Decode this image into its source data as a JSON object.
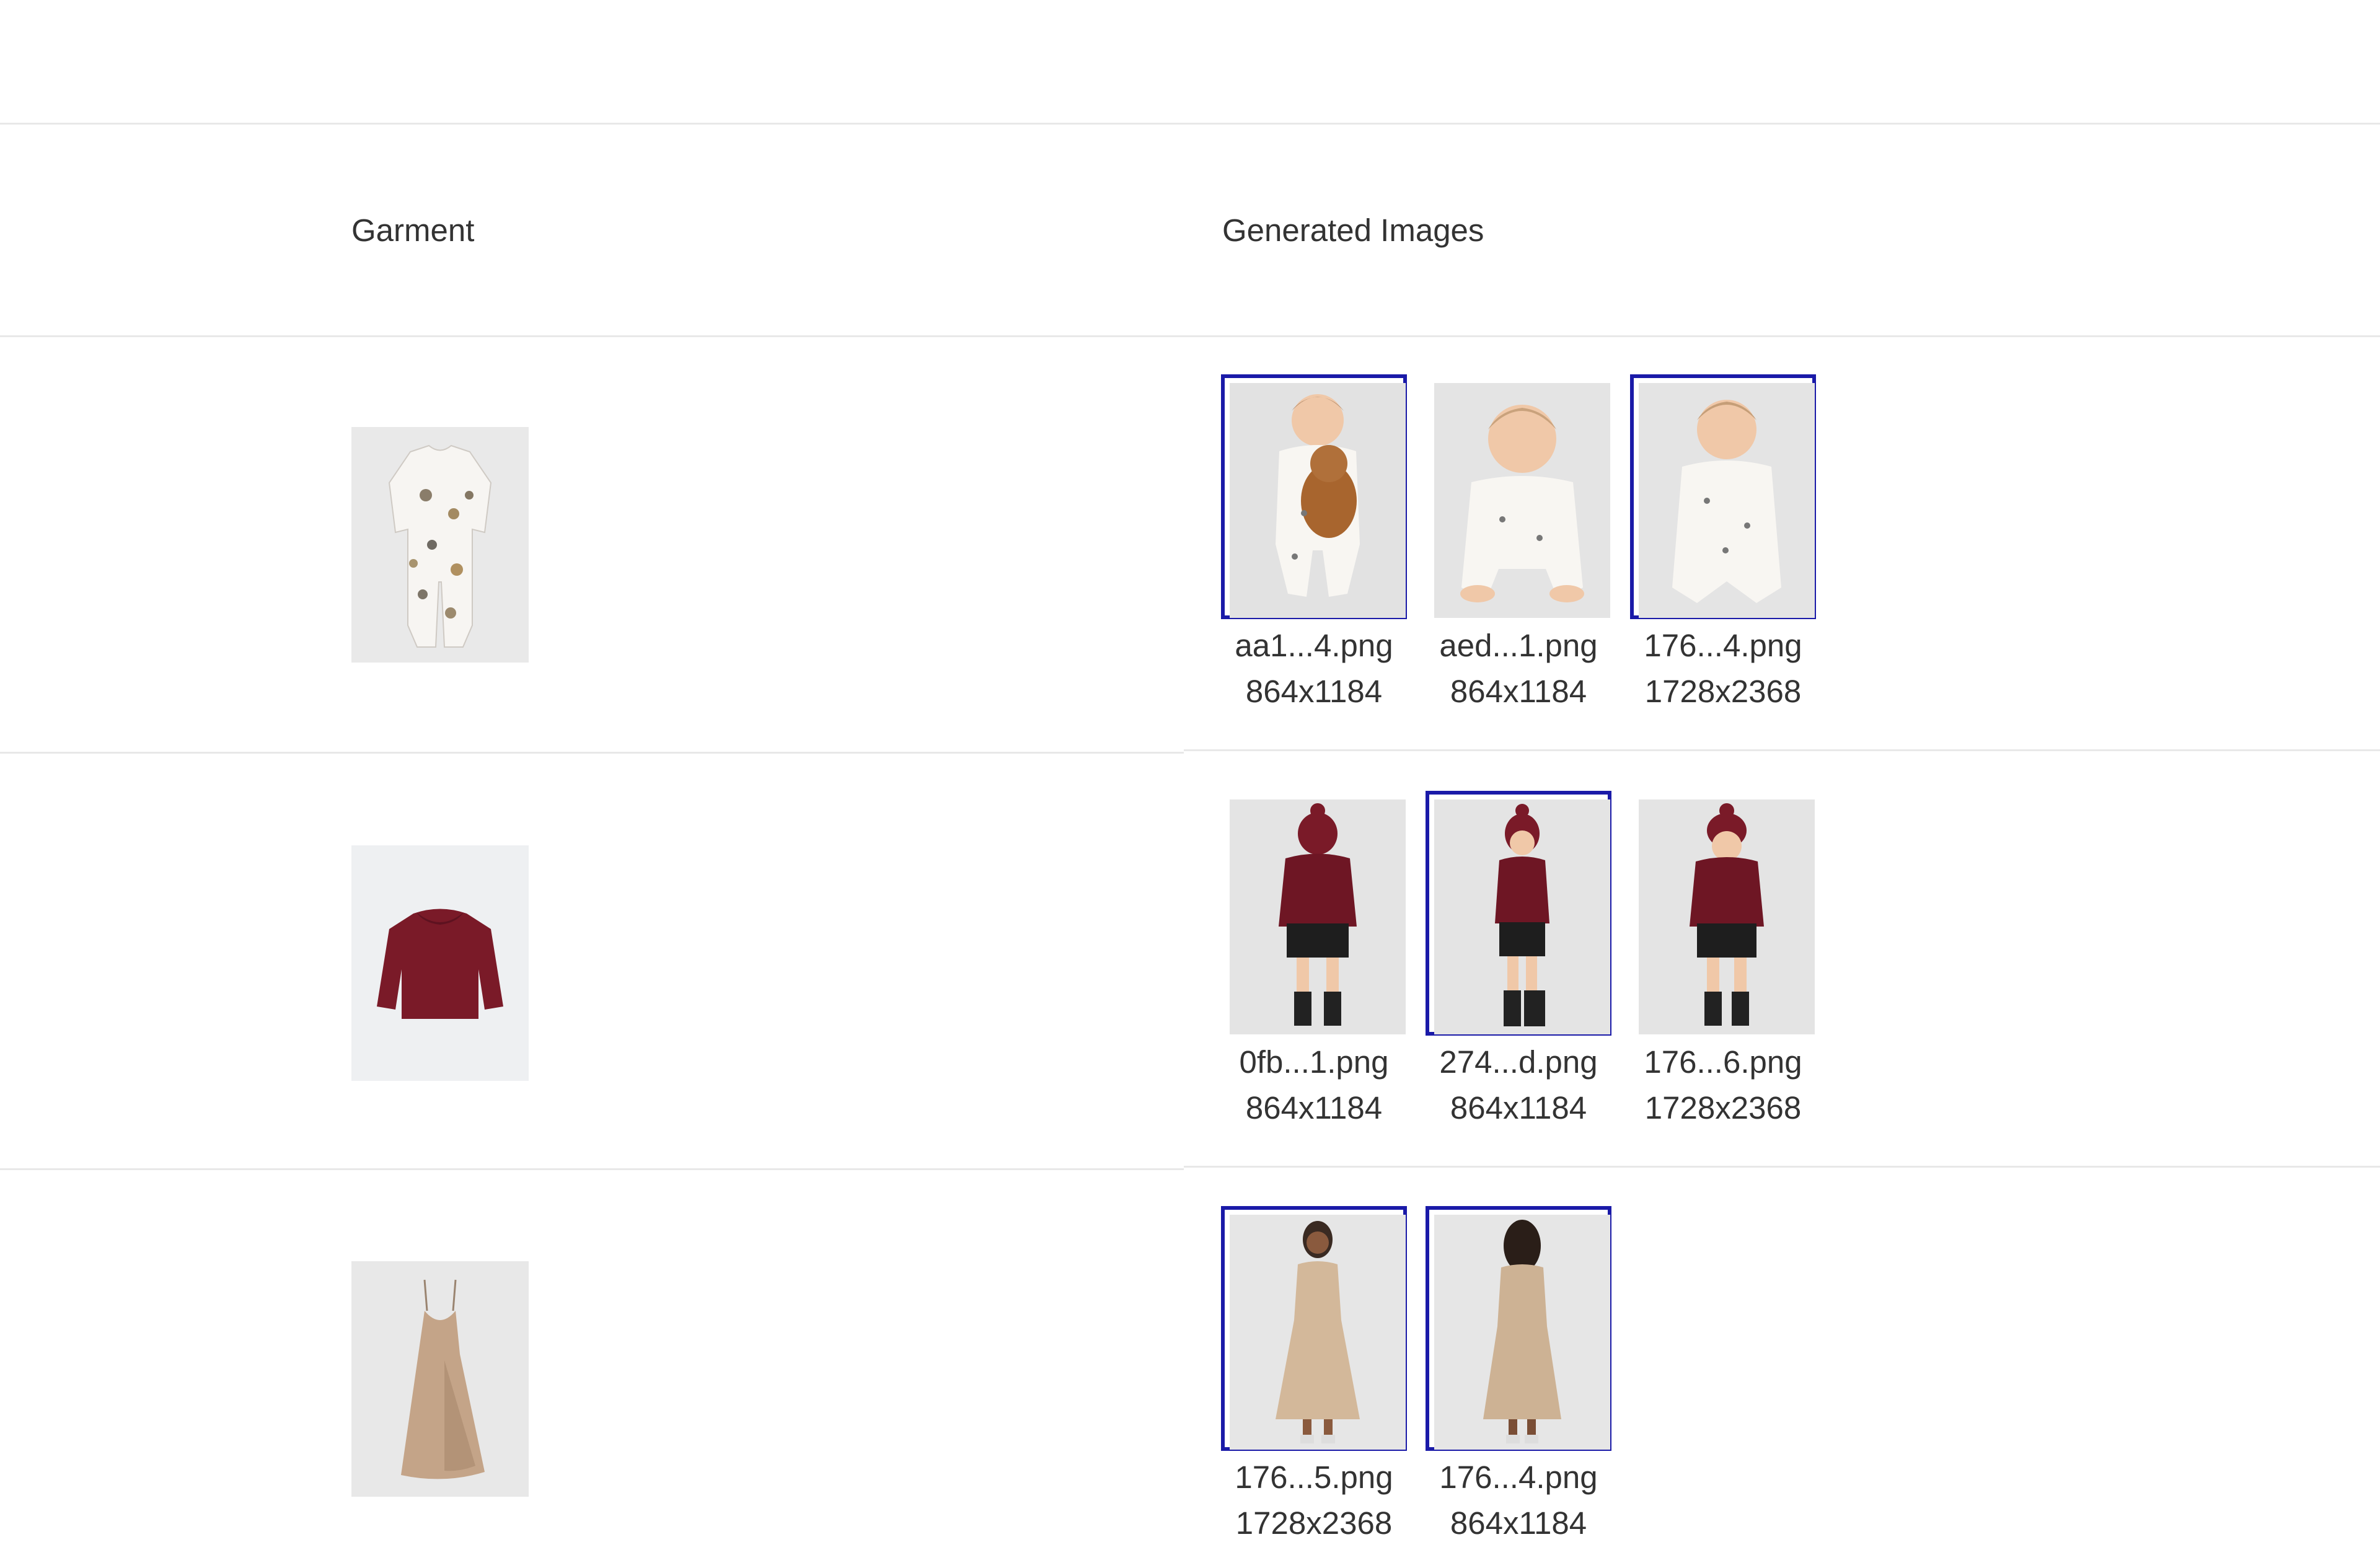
{
  "table": {
    "headers": {
      "garment": "Garment",
      "generated": "Generated Images"
    },
    "rows": [
      {
        "garment_icon": "baby-sleeper-garment-icon",
        "images": [
          {
            "name": "aa1...4.png",
            "dims": "864x1184",
            "selected": true,
            "icon": "baby-with-teddy-photo"
          },
          {
            "name": "aed...1.png",
            "dims": "864x1184",
            "selected": false,
            "icon": "baby-crawling-photo"
          },
          {
            "name": "176...4.png",
            "dims": "1728x2368",
            "selected": true,
            "icon": "baby-sitting-photo"
          }
        ]
      },
      {
        "garment_icon": "burgundy-sweater-garment-icon",
        "images": [
          {
            "name": "0fb...1.png",
            "dims": "864x1184",
            "selected": false,
            "icon": "girl-back-view-photo"
          },
          {
            "name": "274...d.png",
            "dims": "864x1184",
            "selected": true,
            "icon": "girl-side-view-photo"
          },
          {
            "name": "176...6.png",
            "dims": "1728x2368",
            "selected": false,
            "icon": "girl-front-view-photo"
          }
        ]
      },
      {
        "garment_icon": "satin-slip-dress-garment-icon",
        "images": [
          {
            "name": "176...5.png",
            "dims": "1728x2368",
            "selected": true,
            "icon": "woman-front-dress-photo"
          },
          {
            "name": "176...4.png",
            "dims": "864x1184",
            "selected": true,
            "icon": "woman-back-dress-photo"
          }
        ]
      }
    ]
  },
  "colors": {
    "selected_border": "#1a1aa8",
    "divider": "#e8e8e8",
    "text": "#333333"
  }
}
